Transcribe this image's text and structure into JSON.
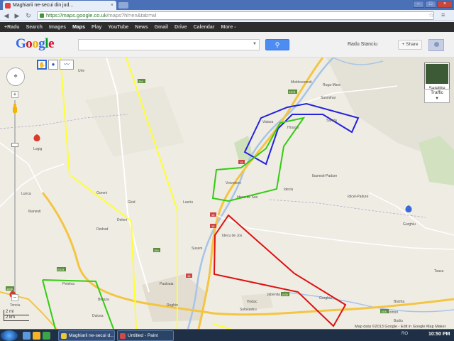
{
  "browser": {
    "tab_title": "Maghiarii ne-secui din jud...",
    "tab_close": "×",
    "url_host": "https://maps.google.co.uk",
    "url_rest": "/maps?hl=en&tab=wl",
    "window_controls": [
      "–",
      "□",
      "×"
    ]
  },
  "gbar": {
    "items": [
      "+Radu",
      "Search",
      "Images",
      "Maps",
      "Play",
      "YouTube",
      "News",
      "Gmail",
      "Drive",
      "Calendar",
      "More -"
    ],
    "active": "Maps"
  },
  "header": {
    "logo_letters": [
      "G",
      "o",
      "o",
      "g",
      "l",
      "e"
    ],
    "search_value": "",
    "user_name": "Radu Stanciu",
    "share_label": "+ Share"
  },
  "map": {
    "satellite_label": "Satellite",
    "traffic_label": "Traffic",
    "scale_mi": "2 mi",
    "scale_km": "2 km",
    "attribution": "Map data ©2013 Google - Edit in Google Map Maker",
    "labels": {
      "lorga": "Logig",
      "urle": "Urle",
      "ruga_mare": "Ruga-Mare",
      "moldovenesti": "Moldovenesti",
      "vatava": "Vatava",
      "sarata": "Sarata",
      "hrusca": "Hrusca",
      "glod": "Glod",
      "deleni": "Deleni",
      "lunca": "Lunca",
      "ibanesti": "Ibanesti",
      "voivodeni": "Voivodeni",
      "idecii_de_sus": "Idecu de Sus",
      "idecii_de_jos": "Idecu de Jos",
      "ideciu": "Ideciu",
      "idicel_padure": "Idicel-Padure",
      "ghiolu": "Gurghiu",
      "solovastru": "Solovastru",
      "jabenita": "Jabenita",
      "reghin": "Reghin",
      "hodac": "Hodac",
      "gurghiu": "Gurghiu",
      "dulcea": "Dulcea",
      "dedrad": "Dedrad",
      "goreni": "Goreni",
      "lueriu": "Lueriu",
      "suseni": "Suseni",
      "breaza": "Breaza",
      "tonciu": "Tonciu",
      "petelea": "Petelea",
      "bisteng": "Bistrita",
      "ibanesti_pad": "Ibanesti-Padure",
      "comori": "Comori",
      "budiu": "Budiu",
      "toaca": "Toaca",
      "sanmihai": "Sanmihai",
      "pauloaia": "Pauloaia"
    },
    "road_numbers": [
      "E578",
      "15",
      "154",
      "15",
      "154",
      "15",
      "1606",
      "E578",
      "15",
      "E578",
      "153C",
      "1530",
      "1530"
    ]
  },
  "taskbar": {
    "tasks": [
      "Maghiarii ne-secui d...",
      "Untitled - Paint"
    ],
    "tray_lang": "RO",
    "clock": "10:50 PM"
  }
}
